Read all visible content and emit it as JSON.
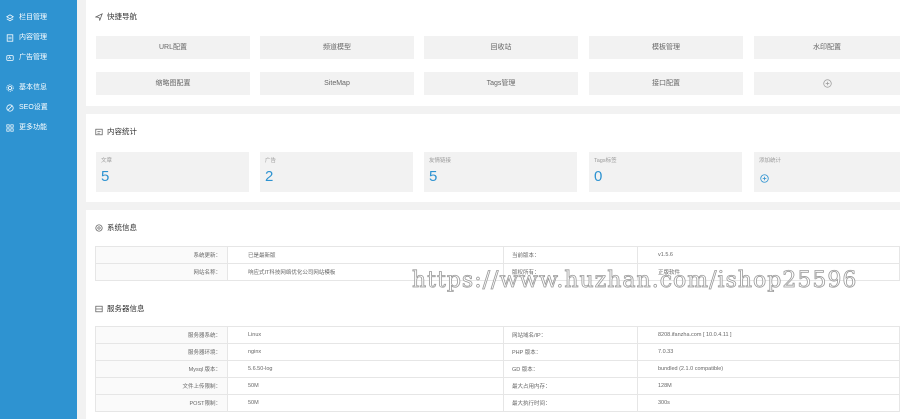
{
  "sidebar": {
    "items": [
      {
        "label": "栏目管理",
        "icon": "layers-icon"
      },
      {
        "label": "内容管理",
        "icon": "document-icon"
      },
      {
        "label": "广告管理",
        "icon": "ad-icon"
      },
      {
        "label": "基本信息",
        "icon": "gear-icon"
      },
      {
        "label": "SEO设置",
        "icon": "seo-icon"
      },
      {
        "label": "更多功能",
        "icon": "grid-icon"
      }
    ]
  },
  "quick_nav": {
    "title": "快捷导航",
    "buttons": [
      "URL配置",
      "频道模型",
      "回收站",
      "模板管理",
      "水印配置",
      "缩略图配置",
      "SiteMap",
      "Tags管理",
      "接口配置"
    ]
  },
  "stats": {
    "title": "内容统计",
    "items": [
      {
        "label": "文章",
        "value": "5"
      },
      {
        "label": "广告",
        "value": "2"
      },
      {
        "label": "友情链接",
        "value": "5"
      },
      {
        "label": "Tags标签",
        "value": "0"
      }
    ],
    "add_label": "添加统计"
  },
  "system": {
    "title": "系统信息",
    "rows": [
      [
        "系统更新：",
        "已是最新版",
        "当前版本：",
        "v1.5.6"
      ],
      [
        "网站名称：",
        "响应式IT科技网络优化公司网站模板",
        "版权所有：",
        "正版软件"
      ]
    ]
  },
  "server": {
    "title": "服务器信息",
    "rows": [
      [
        "服务器系统：",
        "Linux",
        "网站域名/IP：",
        "8208.ifanzha.com [ 10.0.4.11 ]"
      ],
      [
        "服务器环境：",
        "nginx",
        "PHP 版本：",
        "7.0.33"
      ],
      [
        "Mysql 版本：",
        "5.6.50-log",
        "GD 版本：",
        "bundled (2.1.0 compatible)"
      ],
      [
        "文件上传限制：",
        "50M",
        "最大占用内存：",
        "128M"
      ],
      [
        "POST限制：",
        "50M",
        "最大执行时间：",
        "300s"
      ]
    ]
  },
  "watermark": "https://www.huzhan.com/ishop25596",
  "colors": {
    "accent": "#2e93d1",
    "sidebar": "#2e93d1",
    "background": "#f2f2f2"
  }
}
